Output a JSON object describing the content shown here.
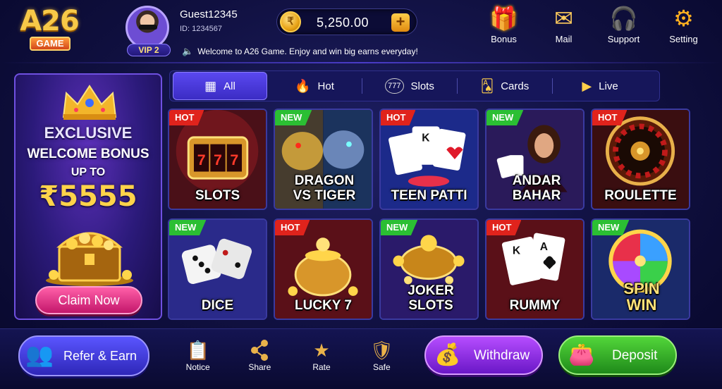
{
  "logo": {
    "main": "A26",
    "sub": "GAME"
  },
  "user": {
    "name": "Guest12345",
    "id": "ID: 1234567",
    "vip": "VIP 2"
  },
  "wallet": {
    "balance": "5,250.00",
    "coin_symbol": "₹",
    "add_symbol": "+"
  },
  "top_nav": [
    {
      "label": "Bonus",
      "icon": "gift-icon",
      "glyph": "🎁"
    },
    {
      "label": "Mail",
      "icon": "mail-icon",
      "glyph": "✉"
    },
    {
      "label": "Support",
      "icon": "headset-icon",
      "glyph": "🎧"
    },
    {
      "label": "Setting",
      "icon": "gear-icon",
      "glyph": "⚙"
    }
  ],
  "marquee": {
    "text": "Welcome to A26 Game. Enjoy and win big earns everyday!"
  },
  "banner": {
    "line1": "EXCLUSIVE",
    "line2": "WELCOME BONUS",
    "line3": "UP TO",
    "amount": "₹5555",
    "cta": "Claim Now"
  },
  "tabs": [
    {
      "label": "All",
      "icon": "grid-icon",
      "glyph": "▦",
      "active": true
    },
    {
      "label": "Hot",
      "icon": "flame-icon",
      "glyph": "🔥",
      "active": false
    },
    {
      "label": "Slots",
      "icon": "slots-777-icon",
      "glyph": "777",
      "active": false
    },
    {
      "label": "Cards",
      "icon": "cards-icon",
      "glyph": "🂡",
      "active": false
    },
    {
      "label": "Live",
      "icon": "video-icon",
      "glyph": "▶",
      "active": false
    }
  ],
  "games": [
    {
      "name": "SLOTS",
      "badge": "HOT"
    },
    {
      "name": "DRAGON VS TIGER",
      "badge": "NEW"
    },
    {
      "name": "TEEN PATTI",
      "badge": "HOT"
    },
    {
      "name": "ANDAR BAHAR",
      "badge": "NEW"
    },
    {
      "name": "ROULETTE",
      "badge": "HOT"
    },
    {
      "name": "DICE",
      "badge": "NEW"
    },
    {
      "name": "LUCKY 7",
      "badge": "HOT"
    },
    {
      "name": "JOKER SLOTS",
      "badge": "NEW"
    },
    {
      "name": "RUMMY",
      "badge": "HOT"
    },
    {
      "name": "SPIN WIN",
      "badge": "NEW"
    }
  ],
  "bottom": {
    "refer": "Refer & Earn",
    "nav": [
      {
        "label": "Notice",
        "icon": "clipboard-icon",
        "glyph": "📋"
      },
      {
        "label": "Share",
        "icon": "share-icon",
        "glyph": "⟨"
      },
      {
        "label": "Rate",
        "icon": "star-podium-icon",
        "glyph": "★"
      },
      {
        "label": "Safe",
        "icon": "shield-rupee-icon",
        "glyph": "🛡"
      }
    ],
    "withdraw": "Withdraw",
    "deposit": "Deposit"
  },
  "colors": {
    "hot_badge": "#e0231c",
    "new_badge": "#2bbf33",
    "accent": "#5a48f0"
  }
}
